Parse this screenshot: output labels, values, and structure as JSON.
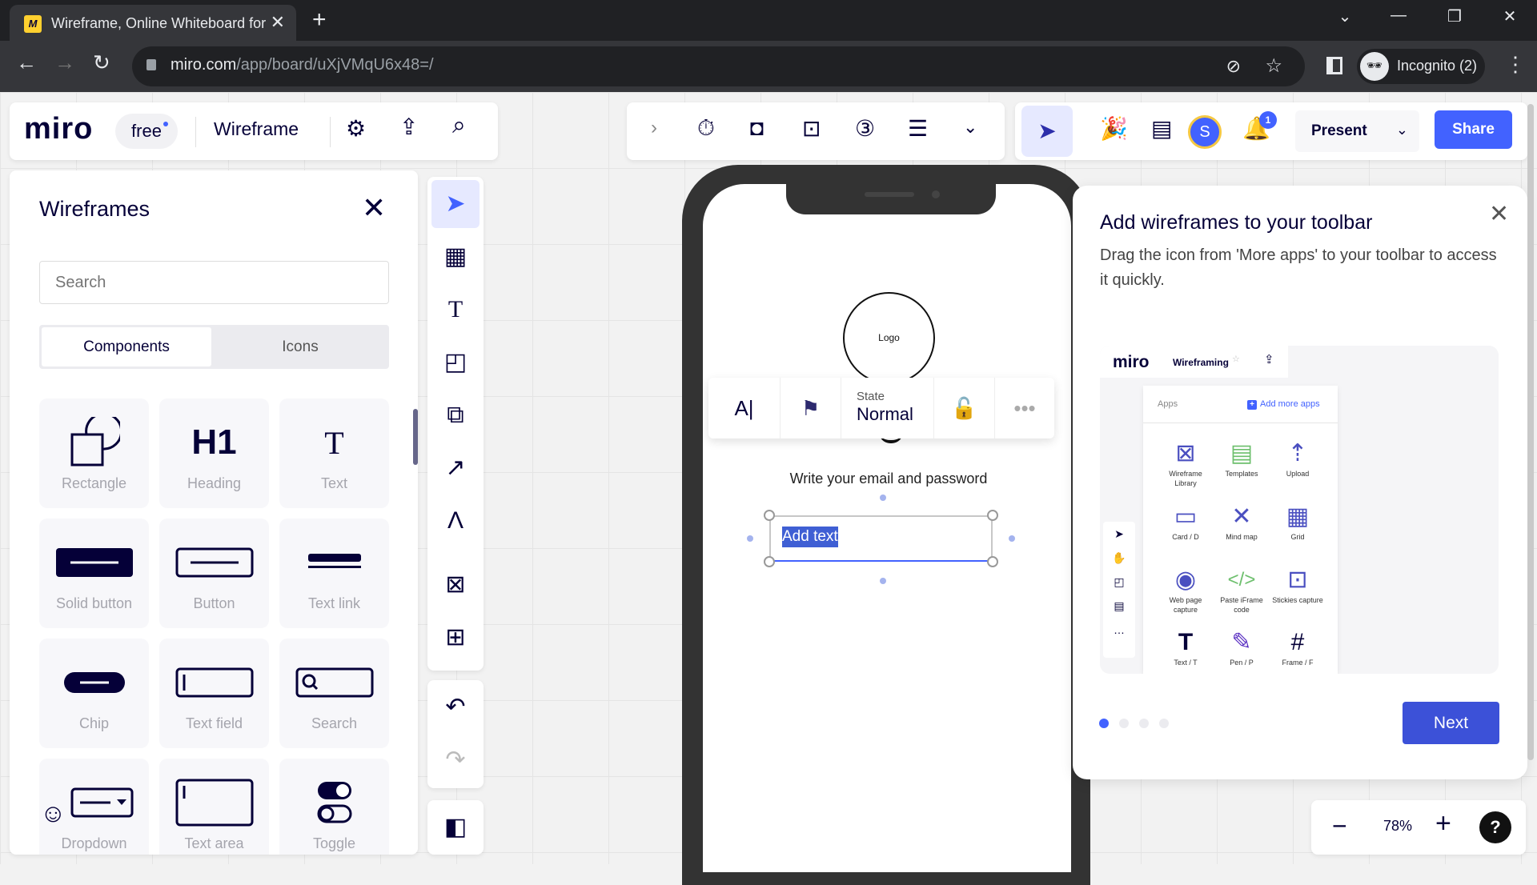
{
  "browser": {
    "tab_title": "Wireframe, Online Whiteboard for",
    "favicon": "miro-icon",
    "url_host": "miro.com",
    "url_path": "/app/board/uXjVMqU6x48=/",
    "profile": "Incognito (2)"
  },
  "header": {
    "logo": "miro",
    "plan": "free",
    "board_name": "Wireframe",
    "present_label": "Present",
    "share_label": "Share",
    "avatar_initial": "S",
    "notification_count": "1"
  },
  "panel": {
    "title": "Wireframes",
    "search_placeholder": "Search",
    "tabs": [
      "Components",
      "Icons"
    ],
    "active_tab": "Components",
    "components": [
      "Rectangle",
      "Heading",
      "Text",
      "Solid button",
      "Button",
      "Text link",
      "Chip",
      "Text field",
      "Search",
      "Dropdown",
      "Text area",
      "Toggle"
    ],
    "heading_glyph": "H1"
  },
  "phone": {
    "logo_label": "Logo",
    "subtitle": "Write your email and password",
    "selected_text": "Add text"
  },
  "floating_toolbar": {
    "state_label": "State",
    "state_value": "Normal"
  },
  "tour": {
    "title": "Add wireframes to your toolbar",
    "body": "Drag the icon from 'More apps' to your toolbar to access it quickly.",
    "next_label": "Next",
    "steps_total": 4,
    "current_step": 1,
    "illustration": {
      "logo": "miro",
      "board": "Wireframing",
      "apps_label": "Apps",
      "add_more": "Add more apps",
      "apps": [
        "Wireframe Library",
        "Templates",
        "Upload",
        "Card / D",
        "Mind map",
        "Grid",
        "Web page capture",
        "Paste iFrame code",
        "Stickies capture",
        "Text / T",
        "Pen / P",
        "Frame / F"
      ]
    }
  },
  "zoom": {
    "value": "78%"
  },
  "colors": {
    "accent": "#4262ff",
    "dark": "#050038",
    "next": "#3c51d8"
  }
}
